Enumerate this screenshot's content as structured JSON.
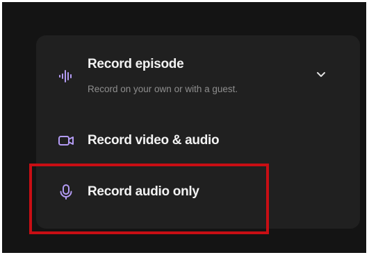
{
  "menu": {
    "episode": {
      "title": "Record episode",
      "subtitle": "Record on your own or with a guest.",
      "icon": "waveform-icon"
    },
    "video": {
      "title": "Record video & audio",
      "icon": "video-camera-icon"
    },
    "audio": {
      "title": "Record audio only",
      "icon": "microphone-icon"
    }
  },
  "colors": {
    "background": "#141414",
    "card": "#202020",
    "text": "#f2f2f2",
    "subtext": "#8e8e8e",
    "accent_icon": "#b49cf5",
    "highlight_box": "#c80e14"
  }
}
